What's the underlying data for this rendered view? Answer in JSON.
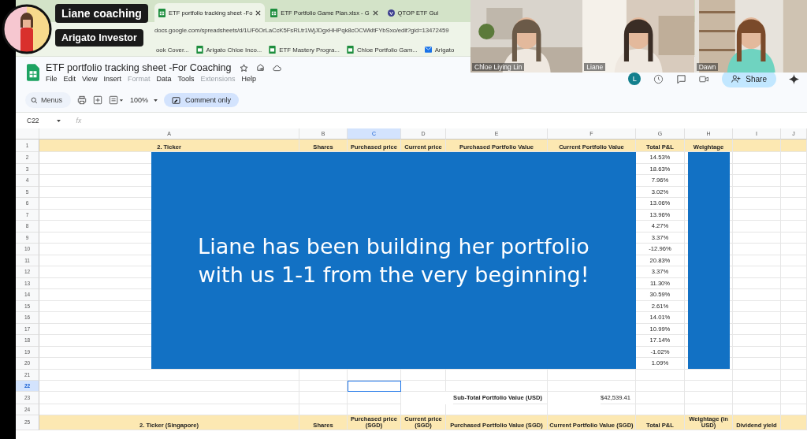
{
  "captions": [
    "Liane coaching",
    "Arigato Investor"
  ],
  "browser": {
    "tabs": [
      {
        "title": "ETF portfolio tracking sheet -Fo",
        "selected": true,
        "closable": true
      },
      {
        "title": "ETF Portfolio Game Plan.xlsx - G",
        "selected": false,
        "closable": true
      },
      {
        "title": "QTOP ETF Gui",
        "selected": false,
        "closable": false
      }
    ],
    "address": "docs.google.com/spreadsheets/d/1UF6OrLaCcK5FsRLtr1WjJDgxHHPqk8cOCWkltFYbSxo/edit?gid=13472459",
    "bookmarks": [
      {
        "label": "ook Cover...",
        "kind": "plain"
      },
      {
        "label": "Arigato Chloe Inco...",
        "kind": "sheet"
      },
      {
        "label": "ETF Mastery Progra...",
        "kind": "sheet"
      },
      {
        "label": "Chloe Portfolio Gam...",
        "kind": "sheet"
      },
      {
        "label": "Arigato",
        "kind": "mail"
      }
    ]
  },
  "doc": {
    "title": "ETF portfolio tracking sheet -For Coaching",
    "menu": [
      {
        "label": "File",
        "disabled": false
      },
      {
        "label": "Edit",
        "disabled": false
      },
      {
        "label": "View",
        "disabled": false
      },
      {
        "label": "Insert",
        "disabled": false
      },
      {
        "label": "Format",
        "disabled": true
      },
      {
        "label": "Data",
        "disabled": false
      },
      {
        "label": "Tools",
        "disabled": false
      },
      {
        "label": "Extensions",
        "disabled": true
      },
      {
        "label": "Help",
        "disabled": false
      }
    ],
    "avatar_letter": "L",
    "share": "Share"
  },
  "toolbar": {
    "search_placeholder": "Menus",
    "zoom": "100%",
    "mode": "Comment only"
  },
  "sheet": {
    "name_box": "C22",
    "fx": "fx",
    "columns": [
      {
        "letter": "A",
        "selected": false
      },
      {
        "letter": "B",
        "selected": false
      },
      {
        "letter": "C",
        "selected": true
      },
      {
        "letter": "D",
        "selected": false
      },
      {
        "letter": "E",
        "selected": false
      },
      {
        "letter": "F",
        "selected": false
      },
      {
        "letter": "G",
        "selected": false
      },
      {
        "letter": "H",
        "selected": false
      },
      {
        "letter": "I",
        "selected": false
      },
      {
        "letter": "J",
        "selected": false
      }
    ],
    "rows": [
      {
        "number": "1",
        "selected": false,
        "kind": "header",
        "cells": [
          "2. Ticker",
          "Shares",
          "Purchased price",
          "Current price",
          "Purchased Portfolio Value",
          "Current Portfolio Value",
          "Total P&L",
          "Weightage"
        ]
      },
      {
        "number": "2",
        "selected": false,
        "kind": "pl",
        "total_pl": "14.53%"
      },
      {
        "number": "3",
        "selected": false,
        "kind": "pl",
        "total_pl": "18.63%"
      },
      {
        "number": "4",
        "selected": false,
        "kind": "pl",
        "total_pl": "7.96%"
      },
      {
        "number": "5",
        "selected": false,
        "kind": "pl",
        "total_pl": "3.02%"
      },
      {
        "number": "6",
        "selected": false,
        "kind": "pl",
        "total_pl": "13.06%"
      },
      {
        "number": "7",
        "selected": false,
        "kind": "pl",
        "total_pl": "13.96%"
      },
      {
        "number": "8",
        "selected": false,
        "kind": "pl",
        "total_pl": "4.27%"
      },
      {
        "number": "9",
        "selected": false,
        "kind": "pl",
        "total_pl": "3.37%"
      },
      {
        "number": "10",
        "selected": false,
        "kind": "pl",
        "total_pl": "-12.96%"
      },
      {
        "number": "11",
        "selected": false,
        "kind": "pl",
        "total_pl": "20.83%"
      },
      {
        "number": "12",
        "selected": false,
        "kind": "pl",
        "total_pl": "3.37%"
      },
      {
        "number": "13",
        "selected": false,
        "kind": "pl",
        "total_pl": "11.30%"
      },
      {
        "number": "14",
        "selected": false,
        "kind": "pl",
        "total_pl": "30.59%"
      },
      {
        "number": "15",
        "selected": false,
        "kind": "pl",
        "total_pl": "2.61%"
      },
      {
        "number": "16",
        "selected": false,
        "kind": "pl",
        "total_pl": "14.01%"
      },
      {
        "number": "17",
        "selected": false,
        "kind": "pl",
        "total_pl": "10.99%"
      },
      {
        "number": "18",
        "selected": false,
        "kind": "pl",
        "total_pl": "17.14%"
      },
      {
        "number": "19",
        "selected": false,
        "kind": "pl",
        "total_pl": "-1.02%"
      },
      {
        "number": "20",
        "selected": false,
        "kind": "pl",
        "total_pl": "1.09%"
      },
      {
        "number": "21",
        "selected": false,
        "kind": "blank"
      },
      {
        "number": "22",
        "selected": true,
        "kind": "blank"
      },
      {
        "number": "23",
        "selected": false,
        "kind": "subtotal",
        "label": "Sub-Total Portfolio Value (USD)",
        "value": "$42,539.41"
      },
      {
        "number": "24",
        "selected": false,
        "kind": "blank"
      },
      {
        "number": "25",
        "selected": false,
        "kind": "header",
        "cells": [
          "2. Ticker (Singapore)",
          "Shares",
          "Purchased price (SGD)",
          "Current price (SGD)",
          "Purchased Portfolio Value (SGD)",
          "Current Portfolio Value (SGD)",
          "Total P&L",
          "Weightage (in USD)",
          "Dividend yield"
        ]
      }
    ],
    "banner": "Liane has been building her portfolio with us 1-1 from the very beginning!"
  },
  "participants": [
    {
      "name": "Chloe Liying Lin",
      "kind": "room"
    },
    {
      "name": "Liane",
      "kind": "blur"
    },
    {
      "name": "Dawn",
      "kind": "shelves"
    }
  ]
}
